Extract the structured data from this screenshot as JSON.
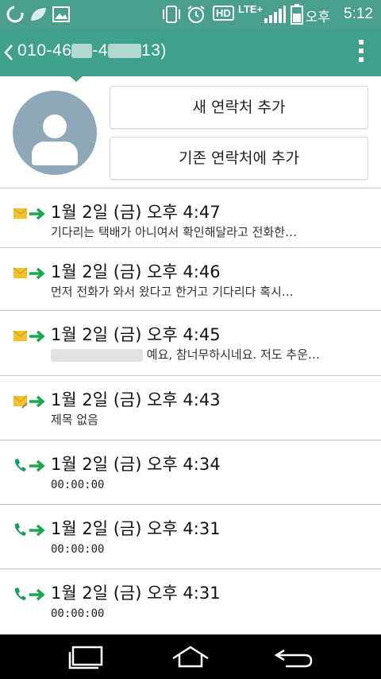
{
  "status_bar": {
    "network": "LTE+",
    "hd": "HD",
    "ampm": "오후",
    "time": "5:12"
  },
  "header": {
    "number_prefix": "010-46",
    "number_middle": "-4",
    "number_suffix": "13)"
  },
  "actions": {
    "new_contact": "새 연락처 추가",
    "add_existing": "기존 연락처에 추가"
  },
  "rows": [
    {
      "type": "message",
      "datetime": "1월 2일 (금) 오후 4:47",
      "snippet": "기다리는 택배가 아니여서 확인해달라고 전화한…"
    },
    {
      "type": "message",
      "datetime": "1월 2일 (금) 오후 4:46",
      "snippet": "먼저 전화가 와서 왔다고 한거고 기다리다 혹시…"
    },
    {
      "type": "message",
      "datetime": "1월 2일 (금) 오후 4:45",
      "snippet": "예요, 참너무하시네요.  저도 추운…"
    },
    {
      "type": "message-attachment",
      "datetime": "1월 2일 (금) 오후 4:43",
      "snippet": "제목 없음"
    },
    {
      "type": "call",
      "datetime": "1월 2일 (금) 오후 4:34",
      "snippet": "00:00:00"
    },
    {
      "type": "call",
      "datetime": "1월 2일 (금) 오후 4:31",
      "snippet": "00:00:00"
    },
    {
      "type": "call",
      "datetime": "1월 2일 (금) 오후 4:31",
      "snippet": "00:00:00"
    }
  ],
  "colors": {
    "status_bar": "#4a9e8c",
    "action_bar": "#3fa18c",
    "outgoing_arrow": "#1aa84e",
    "envelope": "#f3c12b",
    "call_icon": "#1a9a62"
  }
}
